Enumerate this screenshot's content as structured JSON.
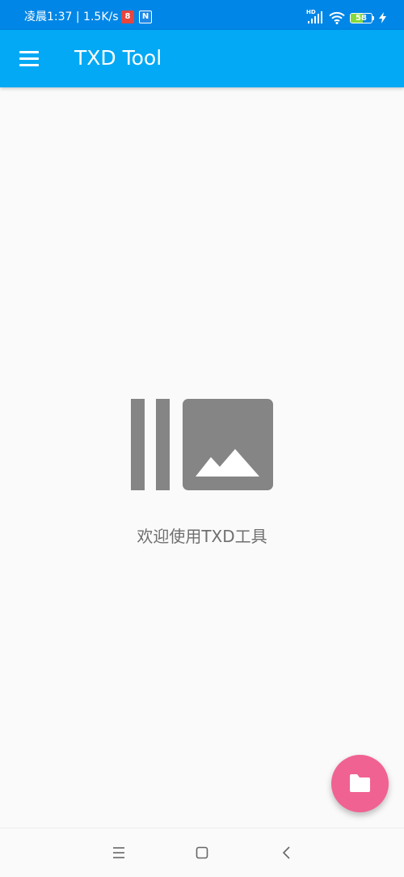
{
  "status_bar": {
    "time_text": "凌晨1:37 | 1.5K/s",
    "notif1_text": "8",
    "notif2_text": "N",
    "battery_level": "58",
    "battery_fraction": 0.58,
    "network_label": "HD",
    "colors": {
      "background": "#0086e6",
      "battery_fill": "#86d93c"
    }
  },
  "app_bar": {
    "title": "TXD Tool",
    "menu_icon": "hamburger-menu-icon",
    "color": "#03a9f4"
  },
  "content": {
    "empty_icon": "image-gallery-icon",
    "welcome_text": "欢迎使用TXD工具"
  },
  "fab": {
    "icon": "folder-icon",
    "color": "#f06292"
  },
  "nav_bar": {
    "menu_icon": "recents-menu-icon",
    "home_icon": "home-square-icon",
    "back_icon": "back-chevron-icon"
  }
}
